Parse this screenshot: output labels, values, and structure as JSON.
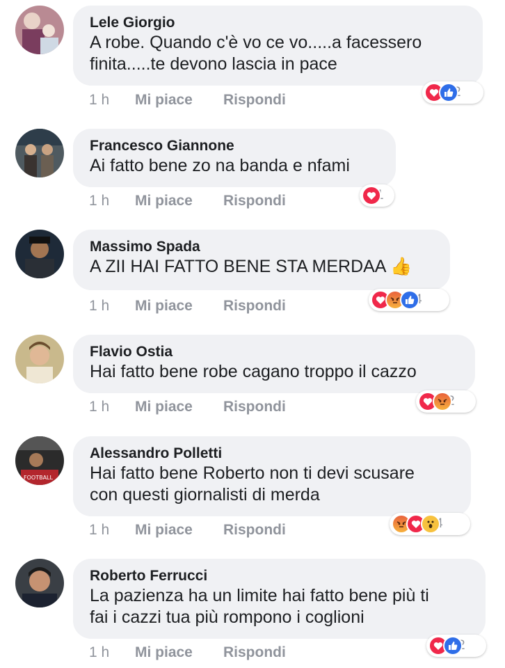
{
  "actions": {
    "like": "Mi piace",
    "reply": "Rispondi"
  },
  "comments": [
    {
      "name": "Lele Giorgio",
      "text": "A robe.  Quando c'è vo ce vo.....a facessero\nfinita.....te devono lascia in pace",
      "time": "1 h",
      "reactions": [
        "love",
        "like"
      ],
      "count": "2",
      "avatar": "avatar-lele"
    },
    {
      "name": "Francesco Giannone",
      "text": "Ai fatto bene zo na banda e nfami",
      "time": "1 h",
      "reactions": [
        "love"
      ],
      "count": "1",
      "avatar": "avatar-francesco"
    },
    {
      "name": "Massimo Spada",
      "text": "A ZII HAI FATTO BENE STA MERDAA 👍",
      "time": "1 h",
      "reactions": [
        "love",
        "angry",
        "like"
      ],
      "count": "4",
      "avatar": "avatar-massimo"
    },
    {
      "name": "Flavio Ostia",
      "text": "Hai fatto bene robe cagano troppo il cazzo",
      "time": "1 h",
      "reactions": [
        "love",
        "angry"
      ],
      "count": "2",
      "avatar": "avatar-flavio"
    },
    {
      "name": "Alessandro Polletti",
      "text": "Hai fatto bene Roberto non ti devi scusare\ncon questi giornalisti di merda",
      "time": "1 h",
      "reactions": [
        "angry",
        "love",
        "wow"
      ],
      "count": "4",
      "avatar": "avatar-alessandro"
    },
    {
      "name": "Roberto Ferrucci",
      "text": "La pazienza ha un limite hai fatto bene più ti\nfai i cazzi tua più rompono i coglioni",
      "time": "1 h",
      "reactions": [
        "love",
        "like"
      ],
      "count": "2",
      "avatar": "avatar-roberto"
    }
  ],
  "colors": {
    "bubble": "#f0f1f4",
    "meta": "#90949c",
    "love": "#f0284a",
    "like": "#2f6ee8",
    "angry": "#f08a3c",
    "wow": "#f7c23e"
  }
}
